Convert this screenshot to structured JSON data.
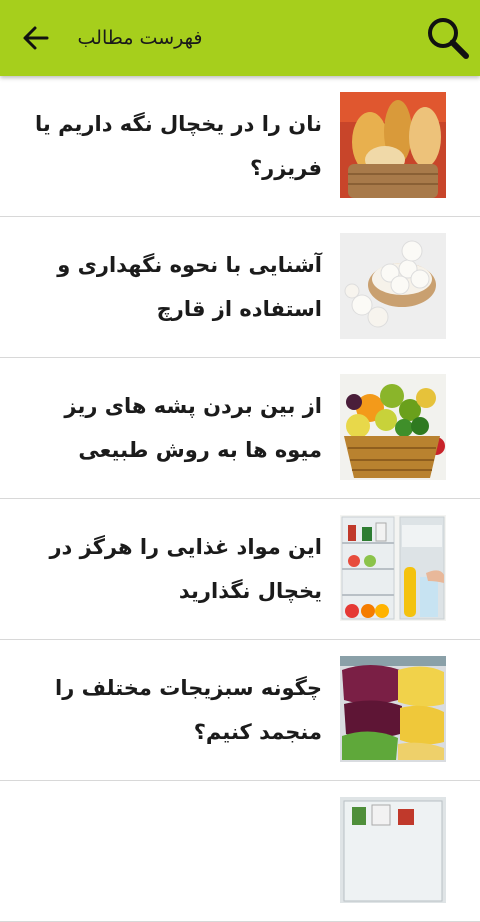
{
  "header": {
    "title": "فهرست مطالب",
    "back_icon": "arrow-left-icon",
    "search_icon": "search-icon",
    "accent_color": "#a6cf1c"
  },
  "articles": [
    {
      "title": "نان را در یخچال نگه داریم یا فریزر؟",
      "image": "bread-basket"
    },
    {
      "title": "آشنایی با نحوه نگهداری و استفاده از قارچ",
      "image": "mushrooms-bowl"
    },
    {
      "title": "از بین بردن پشه های ریز میوه ها به روش طبیعی",
      "image": "fruit-basket"
    },
    {
      "title": "این مواد غذایی را هرگز در یخچال نگذارید",
      "image": "open-fridge"
    },
    {
      "title": "چگونه سبزیجات مختلف را منجمد کنیم؟",
      "image": "frozen-vegetable-bags"
    },
    {
      "title": "",
      "image": "fridge-partial"
    }
  ]
}
